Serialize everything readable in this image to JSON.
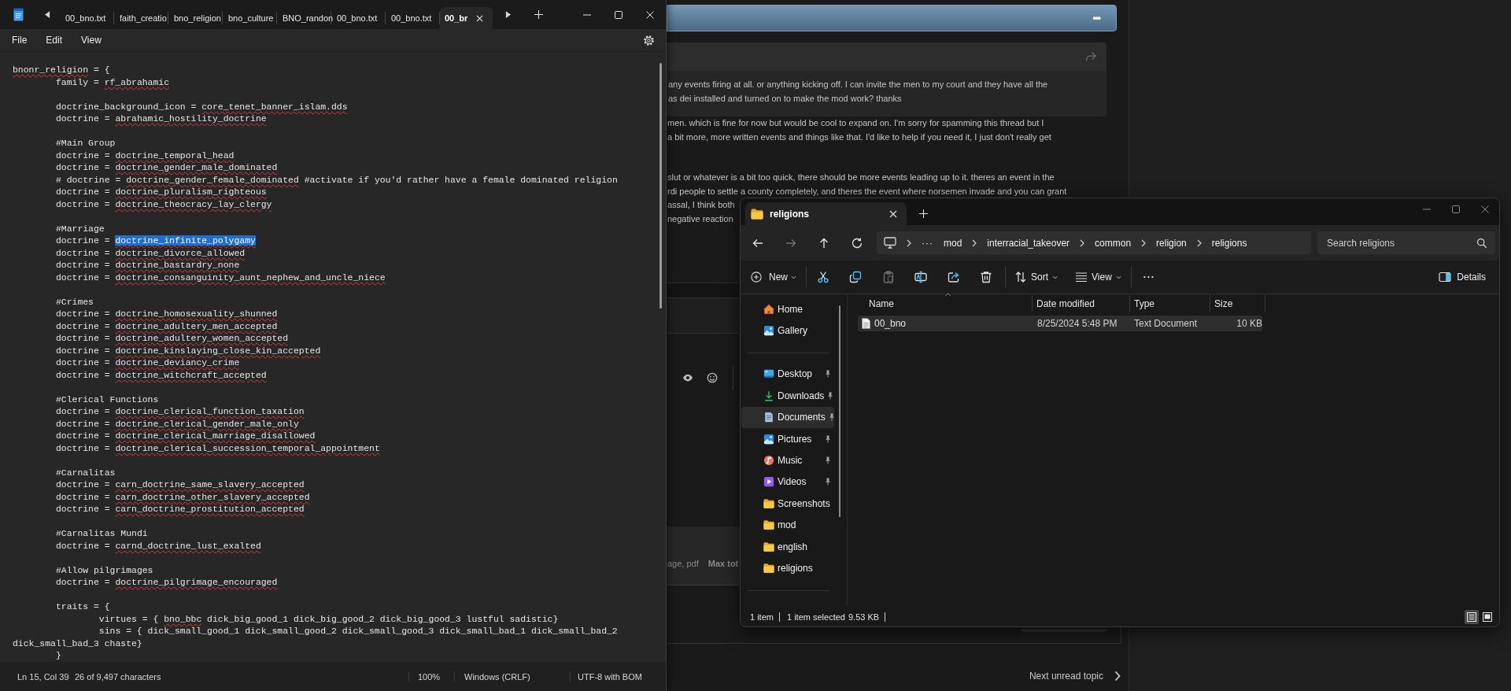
{
  "forum": {
    "header": {
      "menu": "•••"
    },
    "quote": {
      "lines": [
        "any events firing at all. or anything kicking off. I can invite the men to my court and they have all the",
        "as dei installed and turned on to make the mod work? thanks"
      ]
    },
    "paragraphs": [
      {
        "lines": [
          "men. which is fine for now but would be cool to expand on. I'm sorry for spamming this thread but I",
          "a bit more, more written events and things like that. I'd like to help if you need it, I just don't really get"
        ]
      },
      {
        "lines": [
          "slut or whatever is a bit too quick, there should be more events leading up to it. theres an event in the",
          "rdi people to settle a county completely, and theres the event where norsemen invade and you can grant",
          "assal, I think both",
          "negative reaction"
        ]
      }
    ],
    "attachments": {
      "types": "age, pdf",
      "limit": "Max tot"
    },
    "next_topic": "Next unread topic"
  },
  "notepad": {
    "tabs": [
      {
        "label": "00_bno.txt",
        "selected": false
      },
      {
        "label": "faith_creatio",
        "selected": false
      },
      {
        "label": "bno_religion",
        "selected": false
      },
      {
        "label": "bno_culture",
        "selected": false
      },
      {
        "label": "BNO_randon",
        "selected": false
      },
      {
        "label": "00_bno.txt",
        "selected": false
      },
      {
        "label": "00_bno.txt",
        "selected": false
      },
      {
        "label": "00_br",
        "selected": true
      }
    ],
    "menu": [
      "File",
      "Edit",
      "View"
    ],
    "blocks": [
      {
        "lines": [
          [
            {
              "kind": "misspelled",
              "text": "bnonr_religion"
            },
            {
              "kind": "plain",
              "text": " = {"
            }
          ],
          [
            {
              "kind": "plain",
              "text": "\tfamily = "
            },
            {
              "kind": "misspelled",
              "text": "rf_abrahamic"
            }
          ]
        ]
      },
      {
        "lines": [
          [
            {
              "kind": "plain",
              "text": "\tdoctrine_background_icon = "
            },
            {
              "kind": "misspelled",
              "text": "core_tenet_banner_islam.dds"
            }
          ],
          [
            {
              "kind": "plain",
              "text": "\tdoctrine = "
            },
            {
              "kind": "misspelled",
              "text": "abrahamic_hostility_doctrine"
            }
          ]
        ]
      },
      {
        "lines": [
          [
            {
              "kind": "plain",
              "text": "\t#Main Group"
            }
          ],
          [
            {
              "kind": "plain",
              "text": "\tdoctrine = "
            },
            {
              "kind": "misspelled",
              "text": "doctrine_temporal_head"
            }
          ],
          [
            {
              "kind": "plain",
              "text": "\tdoctrine = "
            },
            {
              "kind": "misspelled",
              "text": "doctrine_gender_male_dominated"
            }
          ],
          [
            {
              "kind": "plain",
              "text": "\t# doctrine = "
            },
            {
              "kind": "misspelled",
              "text": "doctrine_gender_female_dominated"
            },
            {
              "kind": "plain",
              "text": " #activate if you'd rather have a female dominated religion"
            }
          ],
          [
            {
              "kind": "plain",
              "text": "\tdoctrine = "
            },
            {
              "kind": "misspelled",
              "text": "doctrine_pluralism_righteous"
            }
          ],
          [
            {
              "kind": "plain",
              "text": "\tdoctrine = "
            },
            {
              "kind": "misspelled",
              "text": "doctrine_theocracy_lay_clergy"
            }
          ]
        ]
      },
      {
        "lines": [
          [
            {
              "kind": "plain",
              "text": "\t#Marriage"
            }
          ],
          [
            {
              "kind": "plain",
              "text": "\tdoctrine = "
            },
            {
              "kind": "selection",
              "text": "doctrine_infinite_polygamy"
            }
          ],
          [
            {
              "kind": "plain",
              "text": "\tdoctrine = "
            },
            {
              "kind": "misspelled",
              "text": "doctrine_divorce_allowed"
            }
          ],
          [
            {
              "kind": "plain",
              "text": "\tdoctrine = "
            },
            {
              "kind": "misspelled",
              "text": "doctrine_bastardry_none"
            }
          ],
          [
            {
              "kind": "plain",
              "text": "\tdoctrine = "
            },
            {
              "kind": "misspelled",
              "text": "doctrine_consanguinity_aunt_nephew_and_uncle_niece"
            }
          ]
        ]
      },
      {
        "lines": [
          [
            {
              "kind": "plain",
              "text": "\t#Crimes"
            }
          ],
          [
            {
              "kind": "plain",
              "text": "\tdoctrine = "
            },
            {
              "kind": "misspelled",
              "text": "doctrine_homosexuality_shunned"
            }
          ],
          [
            {
              "kind": "plain",
              "text": "\tdoctrine = "
            },
            {
              "kind": "misspelled",
              "text": "doctrine_adultery_men_accepted"
            }
          ],
          [
            {
              "kind": "plain",
              "text": "\tdoctrine = "
            },
            {
              "kind": "misspelled",
              "text": "doctrine_adultery_women_accepted"
            }
          ],
          [
            {
              "kind": "plain",
              "text": "\tdoctrine = "
            },
            {
              "kind": "misspelled",
              "text": "doctrine_kinslaying_close_kin_accepted"
            }
          ],
          [
            {
              "kind": "plain",
              "text": "\tdoctrine = "
            },
            {
              "kind": "misspelled",
              "text": "doctrine_deviancy_crime"
            }
          ],
          [
            {
              "kind": "plain",
              "text": "\tdoctrine = "
            },
            {
              "kind": "misspelled",
              "text": "doctrine_witchcraft_accepted"
            }
          ]
        ]
      },
      {
        "lines": [
          [
            {
              "kind": "plain",
              "text": "\t#Clerical Functions"
            }
          ],
          [
            {
              "kind": "plain",
              "text": "\tdoctrine = "
            },
            {
              "kind": "misspelled",
              "text": "doctrine_clerical_function_taxation"
            }
          ],
          [
            {
              "kind": "plain",
              "text": "\tdoctrine = "
            },
            {
              "kind": "misspelled",
              "text": "doctrine_clerical_gender_male_only"
            }
          ],
          [
            {
              "kind": "plain",
              "text": "\tdoctrine = "
            },
            {
              "kind": "misspelled",
              "text": "doctrine_clerical_marriage_disallowed"
            }
          ],
          [
            {
              "kind": "plain",
              "text": "\tdoctrine = "
            },
            {
              "kind": "misspelled",
              "text": "doctrine_clerical_succession_temporal_appointment"
            }
          ]
        ]
      },
      {
        "lines": [
          [
            {
              "kind": "plain",
              "text": "\t#Carnalitas"
            }
          ],
          [
            {
              "kind": "plain",
              "text": "\tdoctrine = "
            },
            {
              "kind": "misspelled",
              "text": "carn_doctrine_same_slavery_accepted"
            }
          ],
          [
            {
              "kind": "plain",
              "text": "\tdoctrine = "
            },
            {
              "kind": "misspelled",
              "text": "carn_doctrine_other_slavery_accepted"
            }
          ],
          [
            {
              "kind": "plain",
              "text": "\tdoctrine = "
            },
            {
              "kind": "misspelled",
              "text": "carn_doctrine_prostitution_accepted"
            }
          ]
        ]
      },
      {
        "lines": [
          [
            {
              "kind": "plain",
              "text": "\t#Carnalitas Mundi"
            }
          ],
          [
            {
              "kind": "plain",
              "text": "\tdoctrine = "
            },
            {
              "kind": "misspelled",
              "text": "carnd_doctrine_lust_exalted"
            }
          ]
        ]
      },
      {
        "lines": [
          [
            {
              "kind": "plain",
              "text": "\t#Allow pilgrimages"
            }
          ],
          [
            {
              "kind": "plain",
              "text": "\tdoctrine = "
            },
            {
              "kind": "misspelled",
              "text": "doctrine_pilgrimage_encouraged"
            }
          ]
        ]
      },
      {
        "lines": [
          [
            {
              "kind": "plain",
              "text": "\ttraits = {"
            }
          ],
          [
            {
              "kind": "plain",
              "text": "\t\tvirtues = { "
            },
            {
              "kind": "misspelled",
              "text": "bno_bbc"
            },
            {
              "kind": "plain",
              "text": " dick_big_good_1 dick_big_good_2 dick_big_good_3 lustful sadistic}"
            }
          ],
          [
            {
              "kind": "plain",
              "text": "\t\tsins = { dick_small_good_1 dick_small_good_2 dick_small_good_3 dick_small_bad_1 dick_small_bad_2 dick_small_bad_3 chaste}"
            }
          ],
          [
            {
              "kind": "plain",
              "text": "\t}"
            }
          ]
        ]
      }
    ],
    "status": {
      "position": "Ln 15, Col 39",
      "selection": "26 of 9,497 characters",
      "zoom": "100%",
      "line_ending": "Windows (CRLF)",
      "encoding": "UTF-8 with BOM"
    }
  },
  "explorer": {
    "tabs": [
      {
        "label": "religions",
        "selected": true
      }
    ],
    "nav": [
      {
        "kind": "back",
        "disabled": false
      },
      {
        "kind": "forward",
        "disabled": true
      },
      {
        "kind": "up",
        "disabled": false
      },
      {
        "kind": "refresh",
        "disabled": false
      }
    ],
    "address": {
      "overflow": "···",
      "crumbs": [
        "mod",
        "interracial_takeover",
        "common",
        "religion",
        "religions"
      ]
    },
    "search": {
      "placeholder": "Search religions"
    },
    "toolbar": {
      "new": "New",
      "actions": [
        {
          "kind": "cut",
          "disabled": false
        },
        {
          "kind": "copy",
          "disabled": false
        },
        {
          "kind": "paste",
          "disabled": true
        },
        {
          "kind": "rename",
          "disabled": false
        },
        {
          "kind": "share",
          "disabled": false
        },
        {
          "kind": "delete",
          "disabled": false
        }
      ],
      "sort": "Sort",
      "view": "View",
      "more": "···",
      "details": "Details"
    },
    "sidebar": {
      "sections": [
        {
          "items": [
            {
              "kind": "home",
              "label": "Home",
              "pinned": false,
              "selected": false
            },
            {
              "kind": "gallery",
              "label": "Gallery",
              "pinned": false,
              "selected": false
            }
          ]
        },
        {
          "items": [
            {
              "kind": "desktop",
              "label": "Desktop",
              "pinned": true,
              "selected": false
            },
            {
              "kind": "downloads",
              "label": "Downloads",
              "pinned": true,
              "selected": false
            },
            {
              "kind": "documents",
              "label": "Documents",
              "pinned": true,
              "selected": true
            },
            {
              "kind": "pictures",
              "label": "Pictures",
              "pinned": true,
              "selected": false
            },
            {
              "kind": "music",
              "label": "Music",
              "pinned": true,
              "selected": false
            },
            {
              "kind": "videos",
              "label": "Videos",
              "pinned": true,
              "selected": false
            },
            {
              "kind": "folder",
              "label": "Screenshots",
              "pinned": false,
              "selected": false
            },
            {
              "kind": "folder",
              "label": "mod",
              "pinned": false,
              "selected": false
            },
            {
              "kind": "folder",
              "label": "english",
              "pinned": false,
              "selected": false
            },
            {
              "kind": "folder",
              "label": "religions",
              "pinned": false,
              "selected": false
            }
          ]
        }
      ]
    },
    "files": {
      "columns": [
        {
          "label": "Name",
          "sorted": true
        },
        {
          "label": "Date modified",
          "sorted": false
        },
        {
          "label": "Type",
          "sorted": false
        },
        {
          "label": "Size",
          "sorted": false
        }
      ],
      "rows": [
        {
          "name": "00_bno",
          "modified": "8/25/2024 5:48 PM",
          "type": "Text Document",
          "size": "10 KB",
          "selected": true
        }
      ]
    },
    "status": {
      "count": "1 item",
      "selection": "1 item selected",
      "size": "9.53 KB"
    },
    "view_modes": [
      {
        "kind": "details",
        "selected": true
      },
      {
        "kind": "preview",
        "selected": false
      }
    ]
  }
}
